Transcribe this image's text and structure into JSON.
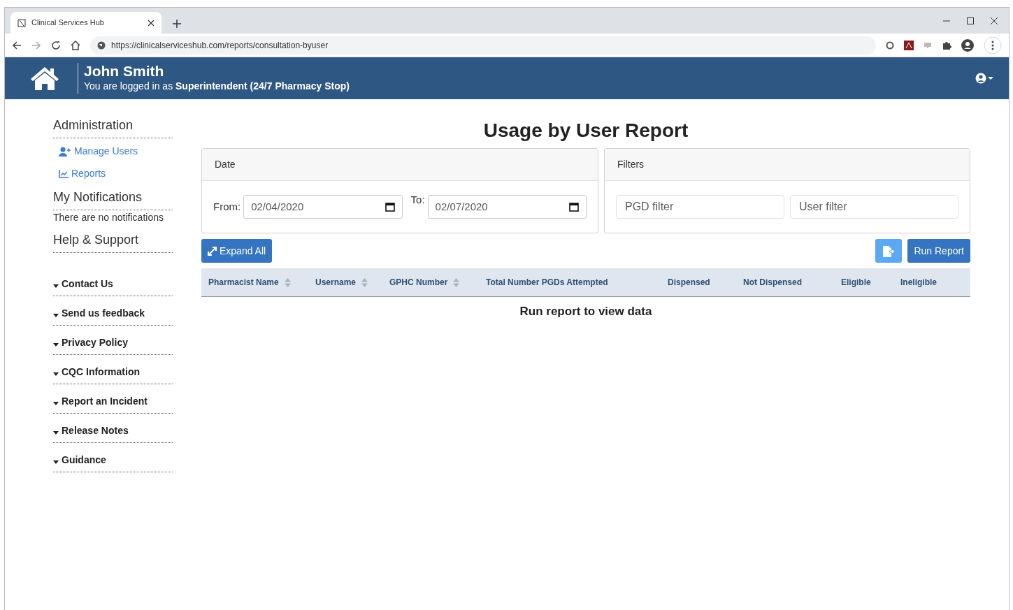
{
  "browser": {
    "tab_title": "Clinical Services Hub",
    "url": "https://clinicalserviceshub.com/reports/consultation-byuser"
  },
  "header": {
    "user_name": "John Smith",
    "logged_in_text": "You are logged in as **Superintendent (24/7 Pharmacy Stop)**"
  },
  "sidebar": {
    "sections": [
      {
        "title": "Administration",
        "links": [
          {
            "label": "Manage Users",
            "kind": "users"
          },
          {
            "label": "Reports",
            "kind": "reports"
          }
        ]
      },
      {
        "title": "My Notifications",
        "note": "There are no notifications"
      },
      {
        "title": "Help & Support",
        "items": [
          "Contact Us",
          "Send us feedback",
          "Privacy Policy",
          "CQC Information",
          "Report an Incident",
          "Release Notes",
          "Guidance"
        ]
      }
    ]
  },
  "page_title": "Usage by User Report",
  "date_card": {
    "title": "Date",
    "from_label": "From:",
    "from_value": "02/04/2020",
    "to_label": "To:",
    "to_value": "02/07/2020"
  },
  "filters_card": {
    "title": "Filters",
    "fields": [
      {
        "placeholder": "PGD filter"
      },
      {
        "placeholder": "User filter"
      }
    ]
  },
  "expand_button": "Expand All",
  "run_button": "Run Report",
  "table": {
    "columns": [
      {
        "label": "Pharmacist Name",
        "sortable": true
      },
      {
        "label": "Username",
        "sortable": true
      },
      {
        "label": "GPHC Number",
        "sortable": true
      },
      {
        "label": "Total Number PGDs Attempted",
        "sortable": false
      },
      {
        "label": "Dispensed",
        "sortable": false
      },
      {
        "label": "Not Dispensed",
        "sortable": false
      },
      {
        "label": "Eligible",
        "sortable": false
      },
      {
        "label": "Ineligible",
        "sortable": false
      }
    ],
    "empty_message": "Run report to view data"
  }
}
